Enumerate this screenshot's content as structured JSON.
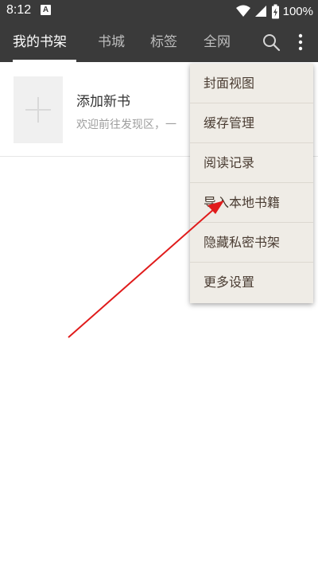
{
  "status_bar": {
    "time": "8:12",
    "notification_glyph": "A",
    "battery_text": "100%",
    "icons": [
      "wifi-icon",
      "signal-icon",
      "battery-icon"
    ]
  },
  "app_bar": {
    "tabs": [
      {
        "label": "我的书架",
        "active": true
      },
      {
        "label": "书城",
        "active": false
      },
      {
        "label": "标签",
        "active": false
      },
      {
        "label": "全网",
        "active": false
      }
    ],
    "icons": [
      "search-icon",
      "more-vertical-icon"
    ]
  },
  "bookshelf": {
    "add_book": {
      "title": "添加新书",
      "description": "欢迎前往发现区，一"
    }
  },
  "menu": {
    "items": [
      {
        "label": "封面视图"
      },
      {
        "label": "缓存管理"
      },
      {
        "label": "阅读记录"
      },
      {
        "label": "导入本地书籍"
      },
      {
        "label": "隐藏私密书架"
      },
      {
        "label": "更多设置"
      }
    ]
  },
  "colors": {
    "app_bar_bg": "#3a3a3a",
    "menu_bg": "#efece6",
    "menu_text": "#4a3c32",
    "annotation_arrow": "#e01b1b"
  }
}
